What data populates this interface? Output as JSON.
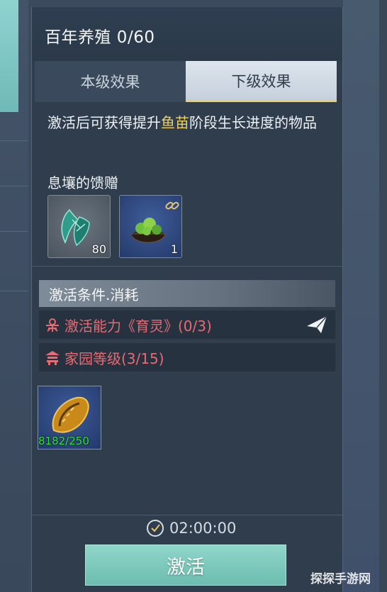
{
  "panel": {
    "title": "百年养殖 0/60",
    "tabs": [
      {
        "label": "本级效果",
        "active": false
      },
      {
        "label": "下级效果",
        "active": true
      }
    ],
    "description": {
      "prefix": "激活后可获得提升",
      "highlight": "鱼苗",
      "suffix": "阶段生长进度的物品"
    },
    "reward_label": "息壤的馈赠",
    "rewards": [
      {
        "icon": "green-crystal-icon",
        "count": "80"
      },
      {
        "icon": "herb-bowl-icon",
        "count": "1"
      }
    ],
    "conditions": {
      "header": "激活条件.消耗",
      "items": [
        {
          "icon": "skill-icon",
          "text": "激活能力《育灵》(0/3)"
        },
        {
          "icon": "home-icon",
          "text": "家园等级(3/15)"
        }
      ]
    },
    "cost": {
      "icon": "golden-shell-icon",
      "count": "8182/250"
    },
    "timer": "02:00:00",
    "activate_label": "激活"
  },
  "watermark": "探探手游网",
  "colors": {
    "highlight": "#f0d15f",
    "condition_unmet": "#e86a72",
    "cost_ok": "#35e035",
    "activate_button": "#7ccabd"
  }
}
